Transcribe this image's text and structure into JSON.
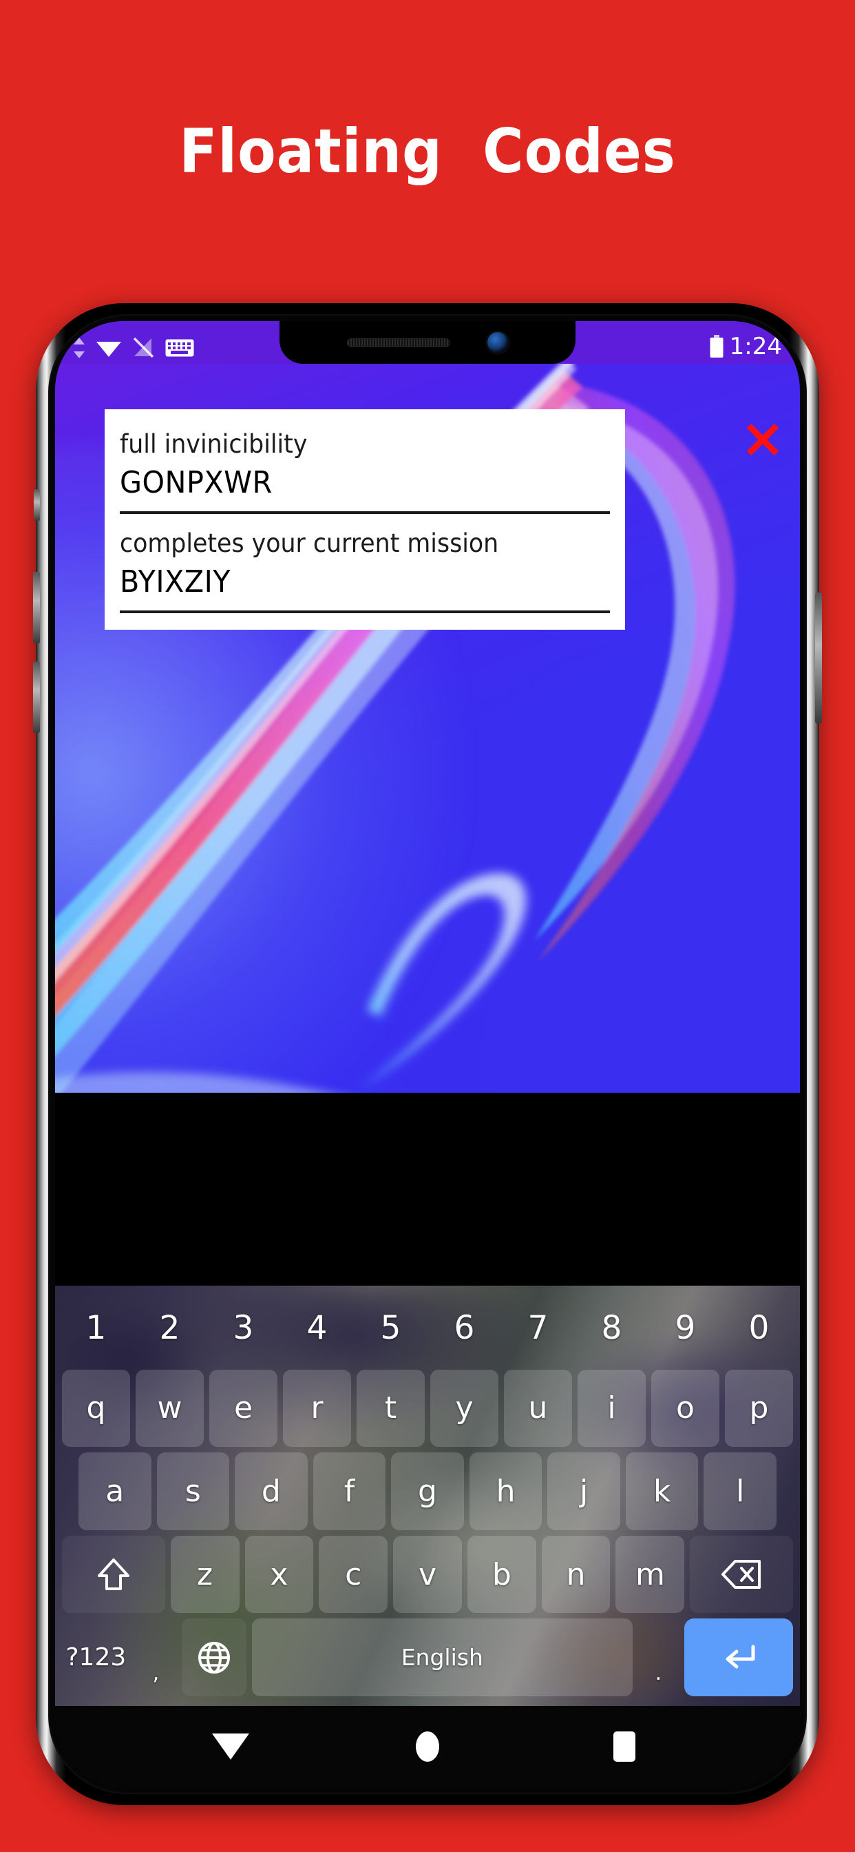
{
  "promo": {
    "title": "Floating  Codes",
    "background_color": "#e02721"
  },
  "device": {
    "frame_color": "#000000",
    "type": "android-phone-notch"
  },
  "status_bar": {
    "background_color": "#5e1ddb",
    "time": "1:24",
    "icons": [
      "data-transfer-icon",
      "wifi-icon",
      "signal-off-icon",
      "keyboard-icon",
      "battery-icon"
    ]
  },
  "app": {
    "accent_color": "#3a2ef0",
    "close_label": "✕",
    "close_color": "#ff1111",
    "card": {
      "background_color": "#ffffff",
      "codes": [
        {
          "description": "full invinicibility",
          "code": "GONPXWR"
        },
        {
          "description": "completes your current mission",
          "code": "BYIXZIY"
        }
      ]
    }
  },
  "keyboard": {
    "language_label": "English",
    "enter_key_color": "#5c9cfb",
    "rows": {
      "numbers": [
        "1",
        "2",
        "3",
        "4",
        "5",
        "6",
        "7",
        "8",
        "9",
        "0"
      ],
      "top": [
        "q",
        "w",
        "e",
        "r",
        "t",
        "y",
        "u",
        "i",
        "o",
        "p"
      ],
      "home": [
        "a",
        "s",
        "d",
        "f",
        "g",
        "h",
        "j",
        "k",
        "l"
      ],
      "bottom": [
        "z",
        "x",
        "c",
        "v",
        "b",
        "n",
        "m"
      ],
      "shift_label": "⇧",
      "backspace_label": "⌫",
      "symbols_label": "?123",
      "comma_label": ",",
      "globe_label": "⊕",
      "period_label": ".",
      "enter_label": "↵"
    }
  },
  "nav_bar": {
    "background_color": "#060606",
    "buttons": [
      "back-button",
      "home-button",
      "recents-button"
    ]
  }
}
